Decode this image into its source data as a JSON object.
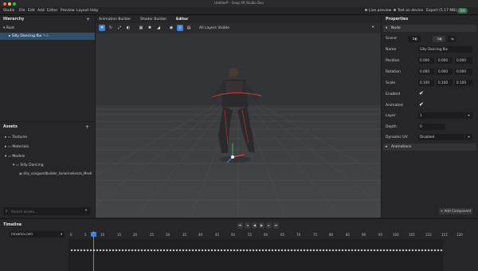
{
  "window": {
    "title": "Untitled* - Snap AR Studio Dev"
  },
  "menu": {
    "items": [
      "Studio",
      "File",
      "Edit",
      "Add",
      "Editor",
      "Preview",
      "Layout",
      "Help"
    ],
    "live_preview": "Live preview",
    "test_on_device": "Test on device",
    "export": "Export (5.17 MB)",
    "avatar": "DM"
  },
  "hierarchy": {
    "title": "Hierarchy",
    "root": "Root",
    "selected_item": "Silly Dancing.fbx"
  },
  "assets": {
    "title": "Assets",
    "items": [
      "Textures",
      "Materials",
      "Models",
      "Silly Dancing",
      "silly_vanguardbuilder_konarinelienza_Mesh"
    ],
    "search_placeholder": "Search assets..."
  },
  "viewport": {
    "tabs": [
      "Animation Builder",
      "Shader Builder",
      "Editor"
    ],
    "layer_filter": "All Layers Visible"
  },
  "properties": {
    "title": "Properties",
    "node_header": "Node",
    "scene_label": "Scene",
    "name_label": "Name",
    "name_value": "Silly Dancing.fbx",
    "position_label": "Position",
    "position": [
      "0.000",
      "0.000",
      "0.000"
    ],
    "rotation_label": "Rotation",
    "rotation": [
      "0.000",
      "0.000",
      "0.000"
    ],
    "scale_label": "Scale",
    "scale": [
      "0.100",
      "0.100",
      "0.100"
    ],
    "enabled_label": "Enabled",
    "animated_label": "Animated",
    "layer_label": "Layer",
    "layer_value": "1",
    "depth_label": "Depth",
    "depth_value": "0",
    "dynamic_uv_label": "Dynamic UV",
    "dynamic_uv_value": "Disabled",
    "animations_header": "Animations",
    "add_component": "+ Add Component"
  },
  "timeline": {
    "title": "Timeline",
    "clip": "mixamo.com",
    "ticks": [
      "0",
      "5",
      "10",
      "15",
      "20",
      "25",
      "30",
      "35",
      "40",
      "45",
      "50",
      "55",
      "60",
      "65",
      "70",
      "75",
      "80",
      "85",
      "90",
      "95",
      "100",
      "105",
      "110",
      "115",
      "120"
    ],
    "current_frame": "7"
  },
  "colors": {
    "accent": "#3b82d6",
    "selection": "#2f4f6f"
  }
}
